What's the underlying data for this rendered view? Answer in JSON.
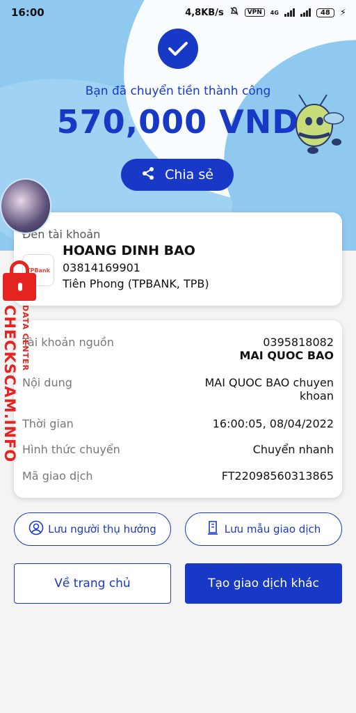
{
  "status_bar": {
    "time": "16:00",
    "speed": "4,8KB/s",
    "vpn": "VPN",
    "network": "4G",
    "battery": "48"
  },
  "result": {
    "subtitle": "Bạn đã chuyển tiền thành công",
    "amount": "570,000 VND",
    "share_label": "Chia sẻ"
  },
  "recipient": {
    "label": "Đến tài khoản",
    "bank_logo_text": "TPBank",
    "name": "HOANG DINH BAO",
    "account": "03814169901",
    "bank": "Tiên Phong (TPBANK, TPB)"
  },
  "details": [
    {
      "key": "Tài khoản nguồn",
      "value": "0395818082",
      "value2": "MAI QUOC BAO"
    },
    {
      "key": "Nội dung",
      "value": "MAI QUOC BAO chuyen",
      "value2": "khoan"
    },
    {
      "key": "Thời gian",
      "value": "16:00:05, 08/04/2022"
    },
    {
      "key": "Hình thức chuyển",
      "value": "Chuyển nhanh"
    },
    {
      "key": "Mã giao dịch",
      "value": "FT22098560313865"
    }
  ],
  "actions": {
    "save_beneficiary": "Lưu người thụ hưởng",
    "save_template": "Lưu mẫu giao dịch",
    "home": "Về trang chủ",
    "new_transaction": "Tạo giao dịch khác"
  },
  "watermark": {
    "main": "CHECKSCAM.INFO",
    "sub": "DATA CENTER"
  },
  "colors": {
    "brand_blue": "#1838c6",
    "hero_bg": "#8fc9f0",
    "watermark_red": "#e52420"
  }
}
